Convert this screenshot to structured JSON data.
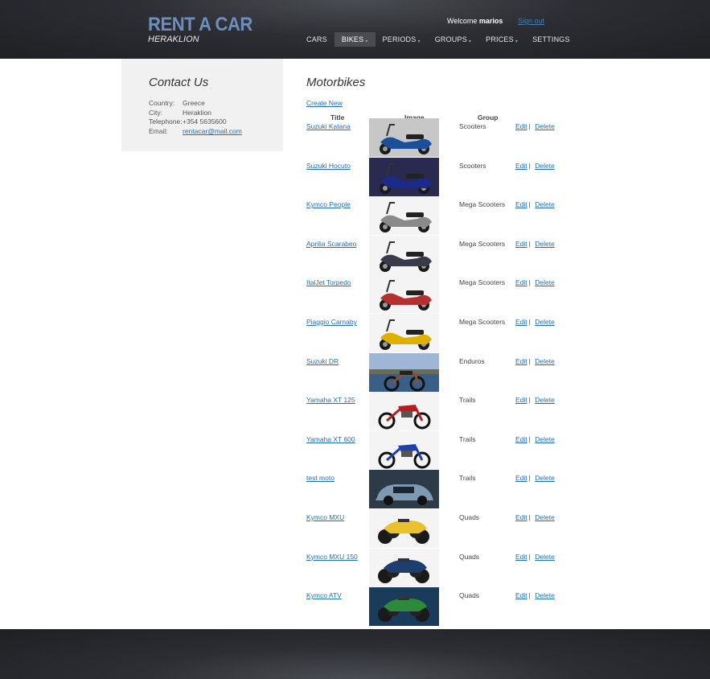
{
  "header": {
    "logo_title": "RENT A CAR",
    "logo_subtitle": "HERAKLION",
    "welcome_text": "Welcome",
    "username": "marios",
    "signout_label": "Sign out"
  },
  "nav": [
    {
      "label": "CARS",
      "has_caret": false
    },
    {
      "label": "BIKES",
      "has_caret": true,
      "active": true
    },
    {
      "label": "PERIODS",
      "has_caret": true
    },
    {
      "label": "GROUPS",
      "has_caret": true
    },
    {
      "label": "PRICES",
      "has_caret": true
    },
    {
      "label": "SETTINGS",
      "has_caret": false
    }
  ],
  "contact": {
    "title": "Contact Us",
    "country_label": "Country:",
    "country": "Greece",
    "city_label": "City:",
    "city": "Heraklion",
    "telephone_label": "Telephone:",
    "telephone": "+354 5635600",
    "email_label": "Email:",
    "email": "rentacar@mail.com"
  },
  "main": {
    "title": "Motorbikes",
    "create_new_label": "Create New",
    "columns": {
      "title": "Title",
      "image": "Image",
      "group": "Group"
    },
    "edit_label": "Edit",
    "delete_label": "Delete",
    "separator": "|",
    "rows": [
      {
        "title": "Suzuki Katana",
        "group": "Scooters",
        "image": "scooter-photo"
      },
      {
        "title": "Suzuki Hocuto",
        "group": "Scooters",
        "image": "scooter-photo"
      },
      {
        "title": "Kymco People",
        "group": "Mega Scooters",
        "image": "scooter-photo"
      },
      {
        "title": "Aprilia Scarabeo",
        "group": "Mega Scooters",
        "image": "scooter-photo"
      },
      {
        "title": "ItalJet Torpedo",
        "group": "Mega Scooters",
        "image": "scooter-photo"
      },
      {
        "title": "Piaggio Carnaby",
        "group": "Mega Scooters",
        "image": "scooter-photo"
      },
      {
        "title": "Suzuki DR",
        "group": "Enduros",
        "image": "enduro-photo"
      },
      {
        "title": "Yamaha XT 125",
        "group": "Trails",
        "image": "trail-bike-photo"
      },
      {
        "title": "Yamaha XT 600",
        "group": "Trails",
        "image": "trail-bike-photo"
      },
      {
        "title": "test moto",
        "group": "Trails",
        "image": "car-photo"
      },
      {
        "title": "Kymco MXU",
        "group": "Quads",
        "image": "quad-photo"
      },
      {
        "title": "Kymco MXU 150",
        "group": "Quads",
        "image": "quad-photo"
      },
      {
        "title": "Kymco ATV",
        "group": "Quads",
        "image": "quad-photo"
      }
    ]
  },
  "colors": {
    "brand": "#6d8fbf",
    "link": "#1f6fae",
    "header_bg": "#2c2e33",
    "sidebar_bg": "#f1f1f1"
  }
}
